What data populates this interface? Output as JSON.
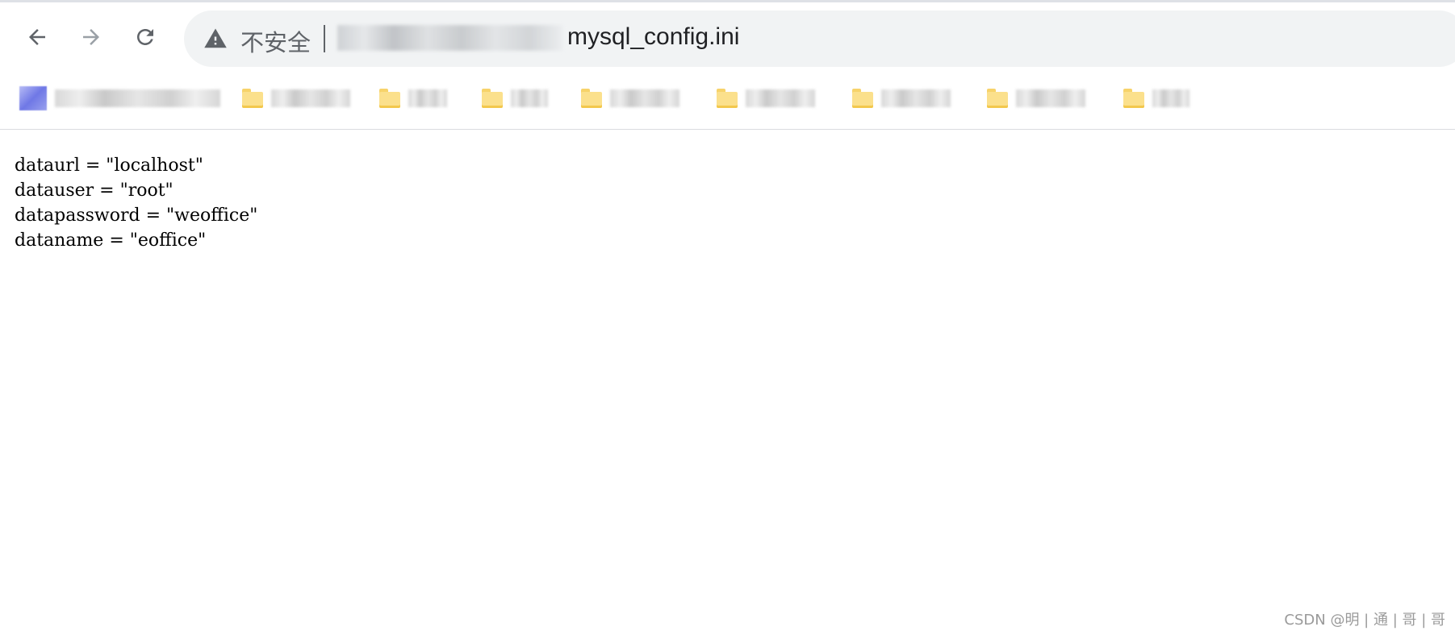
{
  "browser": {
    "toolbar": {
      "back_icon": "arrow-left-icon",
      "forward_icon": "arrow-right-icon",
      "reload_icon": "reload-icon"
    },
    "omnibox": {
      "security_icon": "warning-triangle-icon",
      "security_label": "不安全",
      "url_path": "mysql_config.ini"
    },
    "bookmarks": [
      {
        "type": "site",
        "icon": "site-favicon"
      },
      {
        "type": "folder",
        "icon": "folder-icon"
      },
      {
        "type": "folder",
        "icon": "folder-icon"
      },
      {
        "type": "folder",
        "icon": "folder-icon"
      },
      {
        "type": "folder",
        "icon": "folder-icon"
      },
      {
        "type": "folder",
        "icon": "folder-icon"
      },
      {
        "type": "folder",
        "icon": "folder-icon"
      },
      {
        "type": "folder",
        "icon": "folder-icon"
      },
      {
        "type": "folder",
        "icon": "folder-icon"
      }
    ]
  },
  "page": {
    "lines": [
      "dataurl = \"localhost\"",
      "datauser = \"root\"",
      "datapassword = \"weoffice\"",
      "dataname = \"eoffice\""
    ]
  },
  "watermark": {
    "text": "CSDN @明 | 通 | 哥 | 哥"
  },
  "colors": {
    "omnibox_bg": "#f1f3f4",
    "icon_gray": "#5f6368",
    "icon_disabled": "#9aa0a6",
    "folder_yellow": "#fbe08c"
  }
}
